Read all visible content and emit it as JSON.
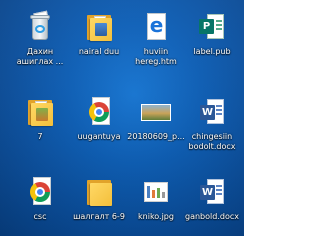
{
  "desktop": {
    "icons": [
      {
        "name": "recycle-bin",
        "line1": "Дахин",
        "line2": "ашиглах ..."
      },
      {
        "name": "nairal-duu",
        "line1": "nairal duu",
        "line2": ""
      },
      {
        "name": "huviin-hereg",
        "line1": "huviin",
        "line2": "hereg.htm"
      },
      {
        "name": "label-pub",
        "line1": "label.pub",
        "line2": ""
      },
      {
        "name": "folder-7",
        "line1": "7",
        "line2": ""
      },
      {
        "name": "uugantuya",
        "line1": "uugantuya",
        "line2": ""
      },
      {
        "name": "photo-20180609",
        "line1": "20180609_p...",
        "line2": ""
      },
      {
        "name": "chingesiin-bodolt",
        "line1": "chingesiin",
        "line2": "bodolt.docx"
      },
      {
        "name": "csc",
        "line1": "csc",
        "line2": ""
      },
      {
        "name": "shalgalt",
        "line1": "шалгалт 6-9",
        "line2": ""
      },
      {
        "name": "kniko-jpg",
        "line1": "kniko.jpg",
        "line2": ""
      },
      {
        "name": "ganbold-docx",
        "line1": "ganbold.docx",
        "line2": ""
      }
    ]
  },
  "colors": {
    "desktop": "#0c5fb8",
    "word": "#2b5797",
    "publisher": "#077568",
    "folder": "#f3bf3a",
    "edge": "#1a73d9"
  },
  "icon_types": [
    "recycle-bin-icon",
    "folder-icon",
    "edge-html-icon",
    "publisher-icon",
    "folder-icon",
    "chrome-shortcut-icon",
    "image-icon",
    "word-document-icon",
    "chrome-shortcut-icon",
    "folder-icon",
    "image-icon",
    "word-document-icon"
  ]
}
